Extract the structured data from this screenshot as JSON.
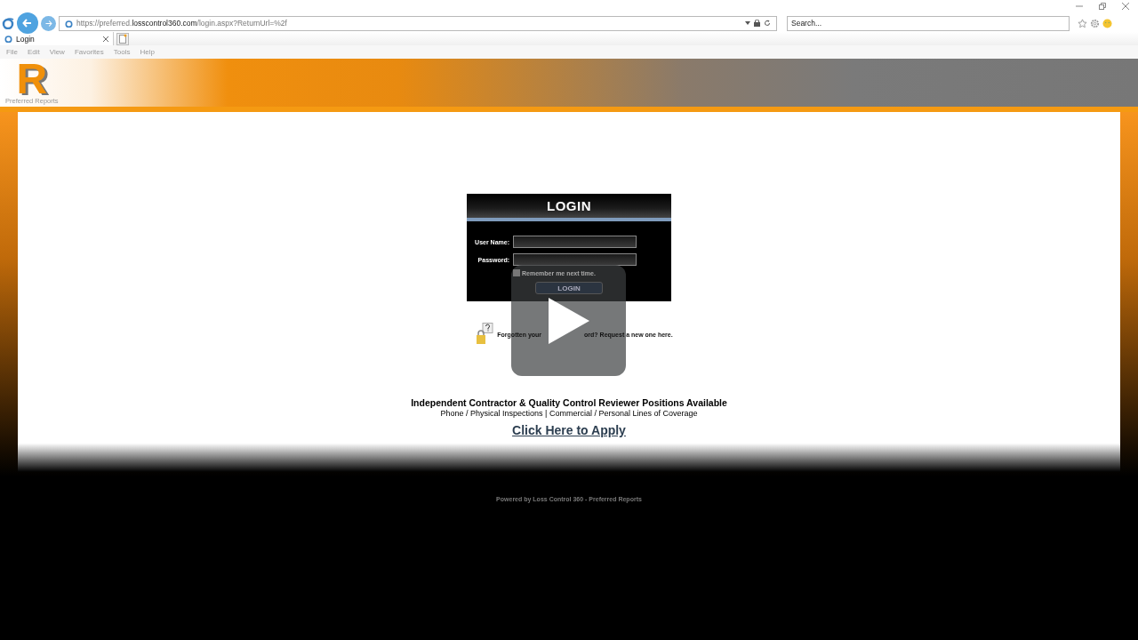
{
  "browser": {
    "url": "https://preferred.**losscontrol360.com**/login.aspx?ReturnUrl=%2f",
    "search": {
      "placeholder": "Search..."
    },
    "tabs": [
      {
        "label": "Login",
        "selected": true
      }
    ],
    "menu": [
      "File",
      "Edit",
      "View",
      "Favorites",
      "Tools",
      "Help"
    ]
  },
  "logo": {
    "letter": "R",
    "caption": "Preferred Reports"
  },
  "login": {
    "title": "LOGIN",
    "fields": [
      {
        "label": "User Name:"
      },
      {
        "label": "Password:"
      }
    ],
    "remember": {
      "label": "Remember me next time.",
      "checked": false
    },
    "button": "LOGIN"
  },
  "forgot": {
    "before": "Forgotten your",
    "after": "ord? Request a new one here."
  },
  "promo": {
    "heading": "Independent Contractor & Quality Control Reviewer Positions Available",
    "subheading": "Phone / Physical Inspections | Commercial / Personal Lines of Coverage",
    "link": "Click Here to Apply"
  },
  "footer": "Powered by Loss Control 360 - Preferred Reports"
}
